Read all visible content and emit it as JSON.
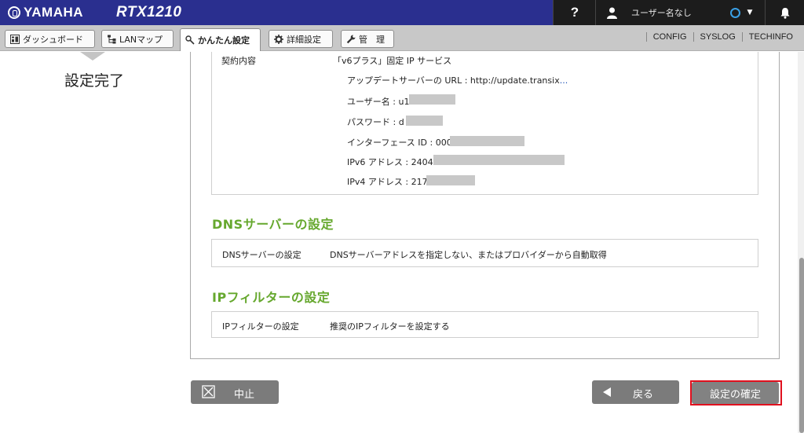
{
  "header": {
    "brand": "YAMAHA",
    "model": "RTX1210",
    "help_label": "?",
    "user_name": "ユーザー名なし",
    "icons": [
      "yamaha-logo-icon",
      "help-icon",
      "user-icon",
      "status-icon",
      "chevron-down-icon",
      "bell-icon"
    ]
  },
  "nav": {
    "tabs": [
      {
        "label": "ダッシュボード",
        "icon": "dashboard-icon"
      },
      {
        "label": "LANマップ",
        "icon": "lan-map-icon"
      },
      {
        "label": "かんたん設定",
        "icon": "wand-icon",
        "active": true
      },
      {
        "label": "詳細設定",
        "icon": "gear-icon"
      },
      {
        "label": "管　理",
        "icon": "wrench-icon"
      }
    ],
    "links": [
      "CONFIG",
      "SYSLOG",
      "TECHINFO"
    ]
  },
  "step": {
    "title": "設定完了"
  },
  "contract": {
    "label": "契約内容",
    "service": "「v6プラス」固定 IP サービス",
    "update_server": "アップデートサーバーの URL : http://update.transix",
    "update_server_more": "...",
    "user_name": "ユーザー名 : u1",
    "password": "パスワード : d",
    "interface_id": "インターフェース ID : 000",
    "ipv6": "IPv6 アドレス : 2404:",
    "ipv4": "IPv4 アドレス : 217"
  },
  "dns": {
    "title": "DNSサーバーの設定",
    "label": "DNSサーバーの設定",
    "value": "DNSサーバーアドレスを指定しない、またはプロバイダーから自動取得"
  },
  "ipfilter": {
    "title": "IPフィルターの設定",
    "label": "IPフィルターの設定",
    "value": "推奨のIPフィルターを設定する"
  },
  "buttons": {
    "cancel": "中止",
    "back": "戻る",
    "confirm": "設定の確定"
  },
  "colors": {
    "header_bg": "#2a2f8f",
    "section_title": "#66a82e",
    "highlight": "#e0101e"
  }
}
